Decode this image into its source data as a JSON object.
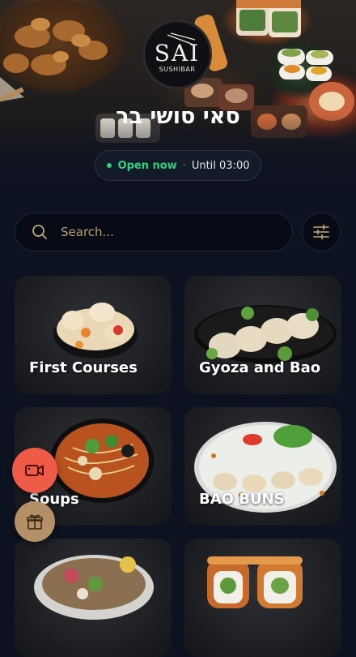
{
  "restaurant": {
    "name": "סאי סושי בר",
    "logo_main": "SAI",
    "logo_sub": "SUSHIBAR"
  },
  "status": {
    "open_label": "Open now",
    "separator": "·",
    "hours": "Until 03:00",
    "open_color": "#2fd17c"
  },
  "search": {
    "placeholder": "Search..."
  },
  "categories": [
    {
      "label": "First Courses"
    },
    {
      "label": "Gyoza and Bao"
    },
    {
      "label": "Soups"
    },
    {
      "label": "BAO BUNS"
    },
    {
      "label": ""
    },
    {
      "label": ""
    }
  ],
  "fabs": {
    "video_icon": "video-camera-icon",
    "gift_icon": "gift-icon",
    "video_color": "#ee5b47",
    "gift_color": "#b39066"
  },
  "accent_color": "#d8b06a"
}
